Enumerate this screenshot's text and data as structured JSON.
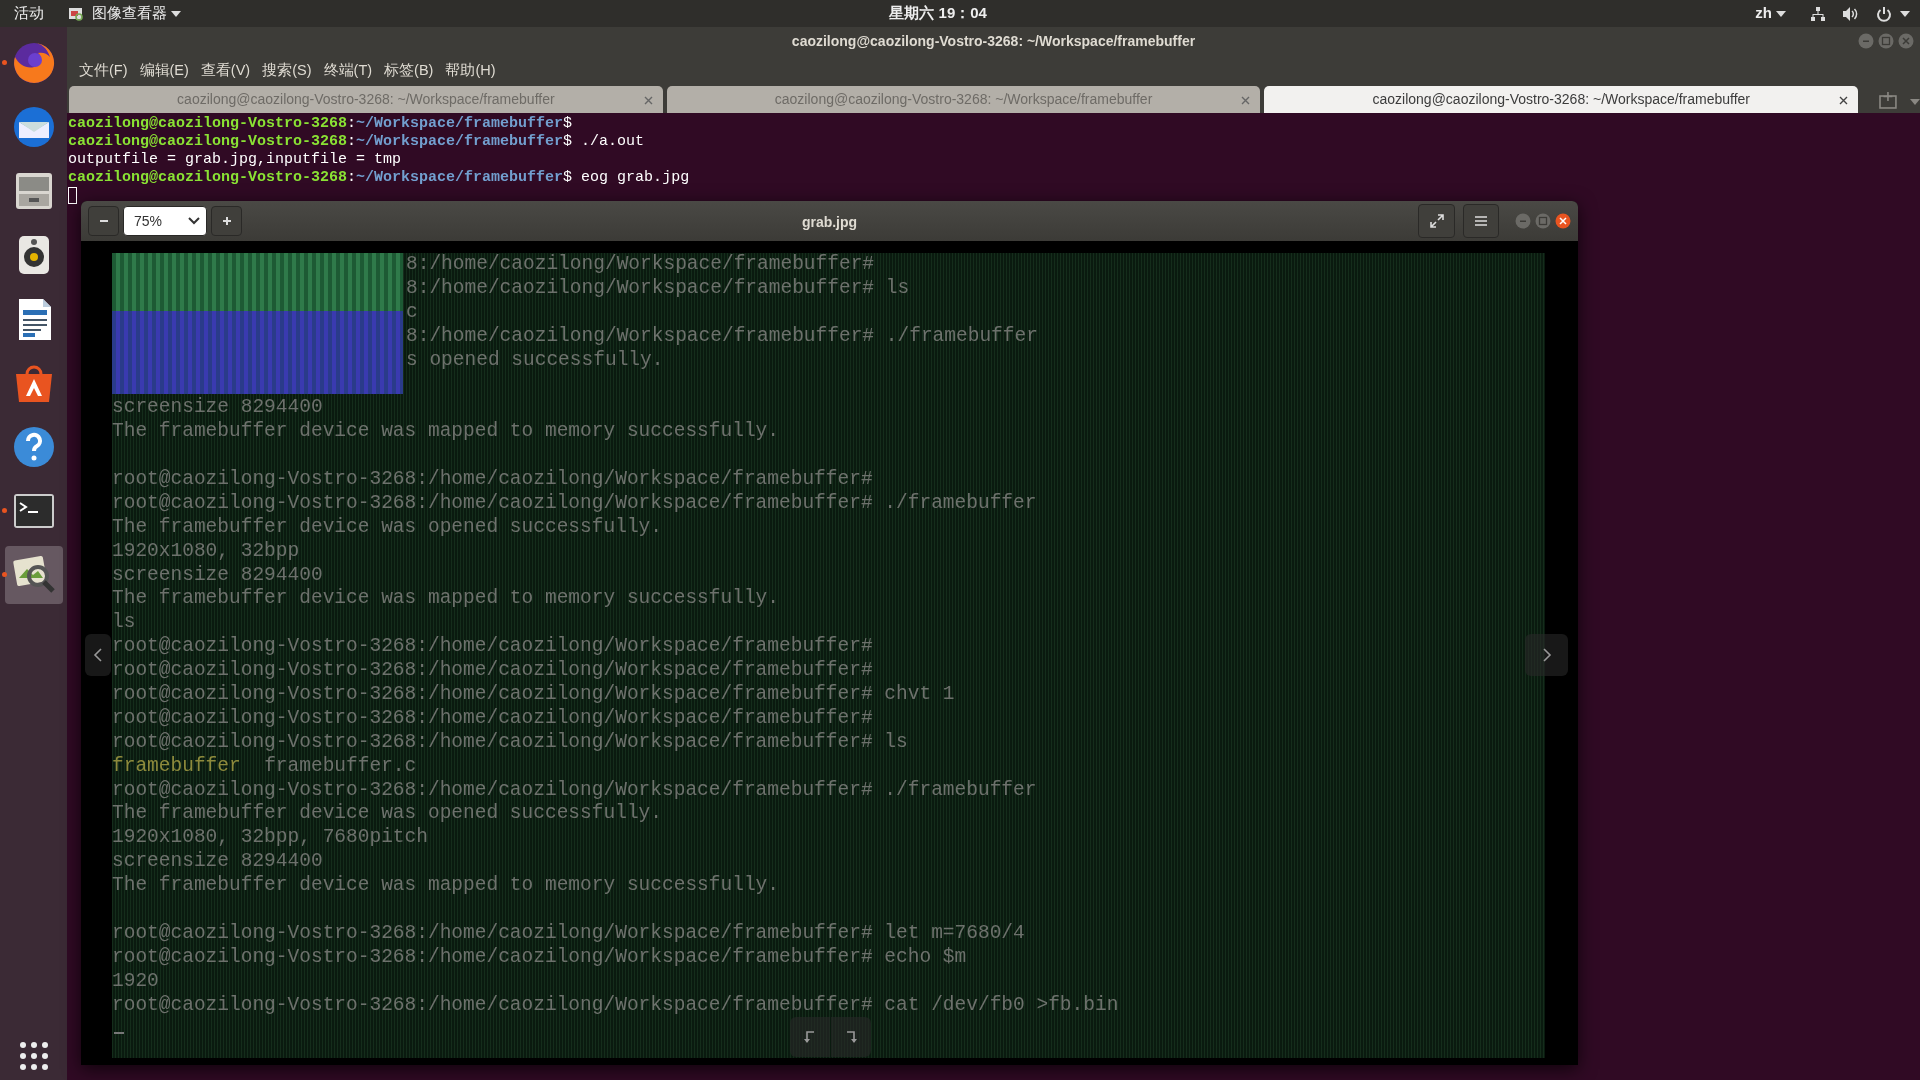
{
  "top_bar": {
    "activities": "活动",
    "app_menu": "图像查看器",
    "clock": "星期六 19：04",
    "input_method": "zh"
  },
  "dock": {
    "items": [
      {
        "kind": "browser",
        "running": true,
        "selected": false
      },
      {
        "kind": "mail",
        "running": false,
        "selected": false
      },
      {
        "kind": "files",
        "running": false,
        "selected": false
      },
      {
        "kind": "music",
        "running": false,
        "selected": false
      },
      {
        "kind": "document",
        "running": false,
        "selected": false
      },
      {
        "kind": "store",
        "running": false,
        "selected": false
      },
      {
        "kind": "help",
        "running": false,
        "selected": false
      },
      {
        "kind": "terminal",
        "running": true,
        "selected": false
      },
      {
        "kind": "viewer",
        "running": true,
        "selected": true
      }
    ]
  },
  "terminal": {
    "title": "caozilong@caozilong-Vostro-3268: ~/Workspace/framebuffer",
    "menus": [
      "文件(F)",
      "编辑(E)",
      "查看(V)",
      "搜索(S)",
      "终端(T)",
      "标签(B)",
      "帮助(H)"
    ],
    "tabs": [
      {
        "label": "caozilong@caozilong-Vostro-3268: ~/Workspace/framebuffer",
        "selected": false
      },
      {
        "label": "caozilong@caozilong-Vostro-3268: ~/Workspace/framebuffer",
        "selected": false
      },
      {
        "label": "caozilong@caozilong-Vostro-3268: ~/Workspace/framebuffer",
        "selected": true
      }
    ],
    "lines": [
      {
        "parts": [
          {
            "kind": "user",
            "text": "caozilong@caozilong-Vostro-3268"
          },
          {
            "kind": "plain",
            "text": ":"
          },
          {
            "kind": "path",
            "text": "~/Workspace/framebuffer"
          },
          {
            "kind": "plain",
            "text": "$"
          }
        ]
      },
      {
        "parts": [
          {
            "kind": "user",
            "text": "caozilong@caozilong-Vostro-3268"
          },
          {
            "kind": "plain",
            "text": ":"
          },
          {
            "kind": "path",
            "text": "~/Workspace/framebuffer"
          },
          {
            "kind": "plain",
            "text": "$ ./a.out"
          }
        ]
      },
      {
        "parts": [
          {
            "kind": "plain",
            "text": "outputfile = grab.jpg,inputfile = tmp"
          }
        ]
      },
      {
        "parts": [
          {
            "kind": "user",
            "text": "caozilong@caozilong-Vostro-3268"
          },
          {
            "kind": "plain",
            "text": ":"
          },
          {
            "kind": "path",
            "text": "~/Workspace/framebuffer"
          },
          {
            "kind": "plain",
            "text": "$ eog grab.jpg"
          }
        ]
      }
    ]
  },
  "viewer": {
    "title": "grab.jpg",
    "zoom": "75%",
    "image": {
      "lines": [
        {
          "kind": "covered",
          "text": "8:/home/caozilong/Workspace/framebuffer#"
        },
        {
          "kind": "covered",
          "text": "8:/home/caozilong/Workspace/framebuffer# ls"
        },
        {
          "kind": "covered",
          "text": "c"
        },
        {
          "kind": "covered",
          "text": "8:/home/caozilong/Workspace/framebuffer# ./framebuffer"
        },
        {
          "kind": "covered",
          "text": "s opened successfully."
        },
        {
          "kind": "blank"
        },
        {
          "kind": "text",
          "text": "screensize 8294400"
        },
        {
          "kind": "text",
          "text": "The framebuffer device was mapped to memory successfully."
        },
        {
          "kind": "blank"
        },
        {
          "kind": "text",
          "text": "root@caozilong-Vostro-3268:/home/caozilong/Workspace/framebuffer#"
        },
        {
          "kind": "text",
          "text": "root@caozilong-Vostro-3268:/home/caozilong/Workspace/framebuffer# ./framebuffer"
        },
        {
          "kind": "text",
          "text": "The framebuffer device was opened successfully."
        },
        {
          "kind": "text",
          "text": "1920x1080, 32bpp"
        },
        {
          "kind": "text",
          "text": "screensize 8294400"
        },
        {
          "kind": "text",
          "text": "The framebuffer device was mapped to memory successfully."
        },
        {
          "kind": "text",
          "text": "ls"
        },
        {
          "kind": "text",
          "text": "root@caozilong-Vostro-3268:/home/caozilong/Workspace/framebuffer#"
        },
        {
          "kind": "text",
          "text": "root@caozilong-Vostro-3268:/home/caozilong/Workspace/framebuffer#"
        },
        {
          "kind": "text",
          "text": "root@caozilong-Vostro-3268:/home/caozilong/Workspace/framebuffer# chvt 1"
        },
        {
          "kind": "text",
          "text": "root@caozilong-Vostro-3268:/home/caozilong/Workspace/framebuffer#"
        },
        {
          "kind": "text",
          "text": "root@caozilong-Vostro-3268:/home/caozilong/Workspace/framebuffer# ls"
        },
        {
          "kind": "listing",
          "parts": [
            {
              "kind": "executable",
              "text": "framebuffer"
            },
            {
              "kind": "file",
              "text": "framebuffer.c"
            }
          ]
        },
        {
          "kind": "text",
          "text": "root@caozilong-Vostro-3268:/home/caozilong/Workspace/framebuffer# ./framebuffer"
        },
        {
          "kind": "text",
          "text": "The framebuffer device was opened successfully."
        },
        {
          "kind": "text",
          "text": "1920x1080, 32bpp, 7680pitch"
        },
        {
          "kind": "text",
          "text": "screensize 8294400"
        },
        {
          "kind": "text",
          "text": "The framebuffer device was mapped to memory successfully."
        },
        {
          "kind": "blank"
        },
        {
          "kind": "text",
          "text": "root@caozilong-Vostro-3268:/home/caozilong/Workspace/framebuffer# let m=7680/4"
        },
        {
          "kind": "text",
          "text": "root@caozilong-Vostro-3268:/home/caozilong/Workspace/framebuffer# echo $m"
        },
        {
          "kind": "text",
          "text": "1920"
        },
        {
          "kind": "text",
          "text": "root@caozilong-Vostro-3268:/home/caozilong/Workspace/framebuffer# cat /dev/fb0 >fb.bin"
        },
        {
          "kind": "cursor"
        }
      ]
    }
  }
}
